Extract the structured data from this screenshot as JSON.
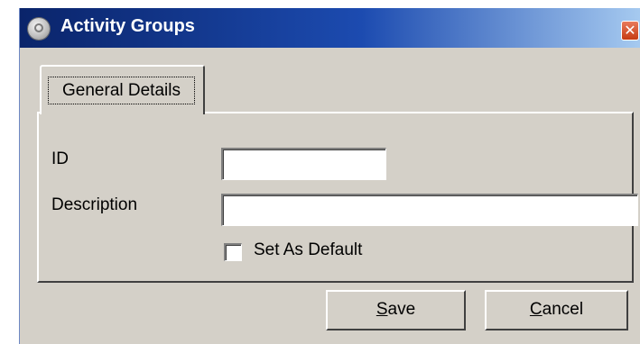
{
  "window": {
    "title": "Activity Groups",
    "close_symbol": "✕",
    "icon": "app-globe-icon"
  },
  "tabs": [
    {
      "label": "General Details",
      "selected": true
    }
  ],
  "form": {
    "id_label": "ID",
    "id_value": "",
    "description_label": "Description",
    "description_value": "",
    "default_label": "Set As Default",
    "default_checked": false
  },
  "buttons": {
    "save": {
      "mnemonic": "S",
      "rest": "ave"
    },
    "cancel": {
      "mnemonic": "C",
      "rest": "ancel"
    }
  },
  "colors": {
    "titlebar_start": "#0a246a",
    "titlebar_end": "#a6caf0",
    "face": "#d4d0c8",
    "close_button": "#c63b13"
  }
}
